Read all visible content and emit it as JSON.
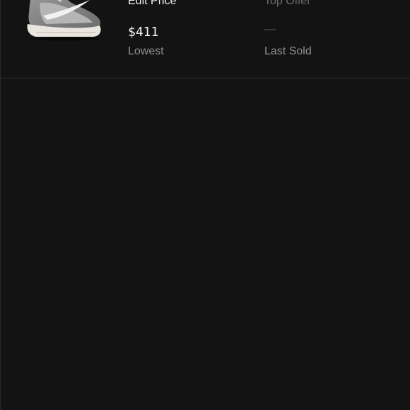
{
  "listing": {
    "product_image": "sneaker-thumbnail",
    "edit_price_label": "Edit Price",
    "top_offer_label": "Top Offer",
    "lowest_value": "$411",
    "lowest_label": "Lowest",
    "last_sold_value": "—",
    "last_sold_label": "Last Sold"
  },
  "colors": {
    "background": "#131313",
    "divider": "#2c2c2c",
    "primary_text": "#f2f2f2",
    "secondary_text": "#8f8f8f"
  }
}
